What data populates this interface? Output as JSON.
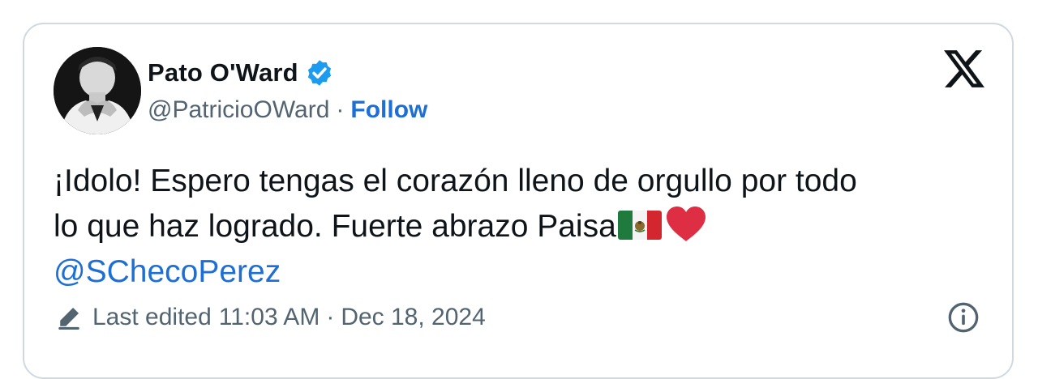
{
  "author": {
    "display_name": "Pato O'Ward",
    "handle": "@PatricioOWard",
    "separator": "·",
    "follow_label": "Follow",
    "verified": true
  },
  "tweet": {
    "line1": "¡Idolo! Espero tengas el corazón lleno de orgullo por todo",
    "line2": "lo que haz logrado. Fuerte abrazo Paisa",
    "emojis": [
      "mexico-flag-icon",
      "red-heart-icon"
    ],
    "mention": "@SChecoPerez"
  },
  "footer": {
    "edited_label": "Last edited",
    "time": "11:03 AM",
    "separator": "·",
    "date": "Dec 18, 2024"
  },
  "colors": {
    "link": "#1d6fd6",
    "verified_badge": "#1d9bf0",
    "secondary_text": "#536471",
    "primary_text": "#0f1419",
    "border": "#cfd9de"
  }
}
